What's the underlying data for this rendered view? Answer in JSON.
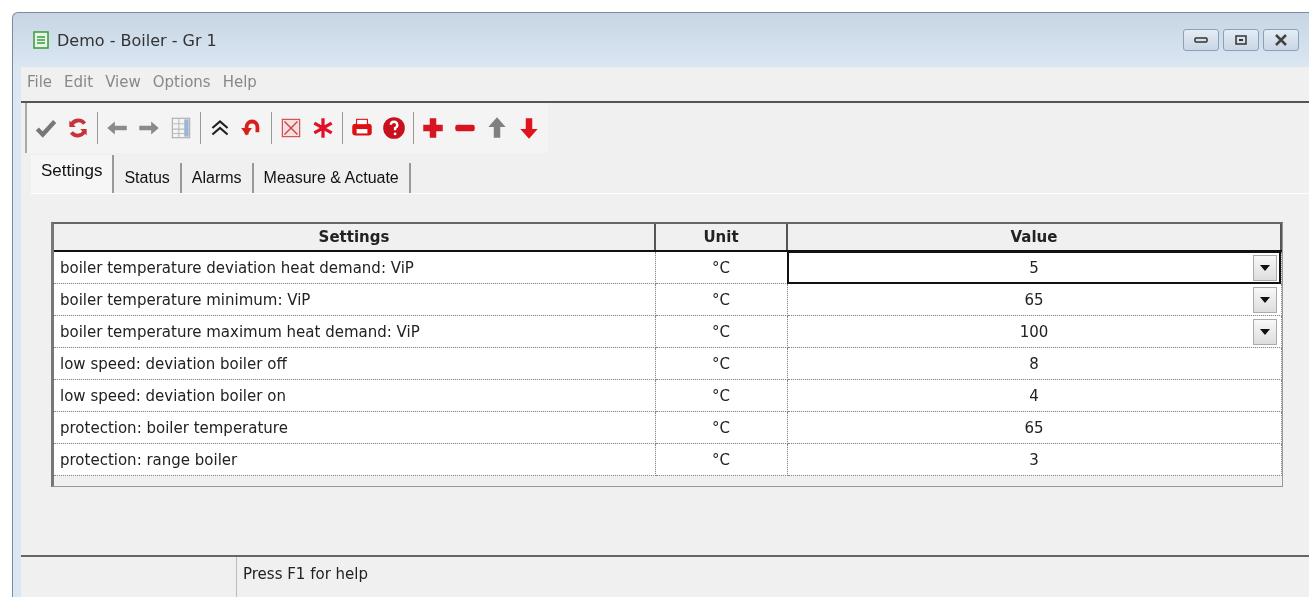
{
  "window": {
    "title": "Demo - Boiler - Gr 1"
  },
  "menu": [
    "File",
    "Edit",
    "View",
    "Options",
    "Help"
  ],
  "toolbar": [
    {
      "kind": "check"
    },
    {
      "kind": "refresh"
    },
    {
      "kind": "sep"
    },
    {
      "kind": "left"
    },
    {
      "kind": "right"
    },
    {
      "kind": "grid"
    },
    {
      "kind": "sep"
    },
    {
      "kind": "caret"
    },
    {
      "kind": "undo"
    },
    {
      "kind": "sep"
    },
    {
      "kind": "xbox"
    },
    {
      "kind": "asterisk"
    },
    {
      "kind": "sep"
    },
    {
      "kind": "print"
    },
    {
      "kind": "help"
    },
    {
      "kind": "sep"
    },
    {
      "kind": "plus"
    },
    {
      "kind": "minus"
    },
    {
      "kind": "up"
    },
    {
      "kind": "down"
    }
  ],
  "tabs": [
    {
      "label": "Settings",
      "selected": true
    },
    {
      "label": "Status",
      "selected": false
    },
    {
      "label": "Alarms",
      "selected": false
    },
    {
      "label": "Measure & Actuate",
      "selected": false
    }
  ],
  "table": {
    "columns": [
      "Settings",
      "Unit",
      "Value"
    ],
    "rows": [
      {
        "setting": "boiler temperature deviation heat demand: ViP",
        "unit": "°C",
        "value": "5",
        "kind": "dropdown",
        "selected": true
      },
      {
        "setting": "boiler temperature minimum: ViP",
        "unit": "°C",
        "value": "65",
        "kind": "dropdown",
        "selected": false
      },
      {
        "setting": "boiler temperature maximum heat demand: ViP",
        "unit": "°C",
        "value": "100",
        "kind": "dropdown",
        "selected": false
      },
      {
        "setting": "low speed: deviation boiler off",
        "unit": "°C",
        "value": "8",
        "kind": "text",
        "selected": false
      },
      {
        "setting": "low speed: deviation boiler on",
        "unit": "°C",
        "value": "4",
        "kind": "text",
        "selected": false
      },
      {
        "setting": "protection: boiler temperature",
        "unit": "°C",
        "value": "65",
        "kind": "text",
        "selected": false
      },
      {
        "setting": "protection: range boiler",
        "unit": "°C",
        "value": "3",
        "kind": "text",
        "selected": false
      }
    ]
  },
  "status_bar": {
    "text": "Press F1 for help"
  }
}
